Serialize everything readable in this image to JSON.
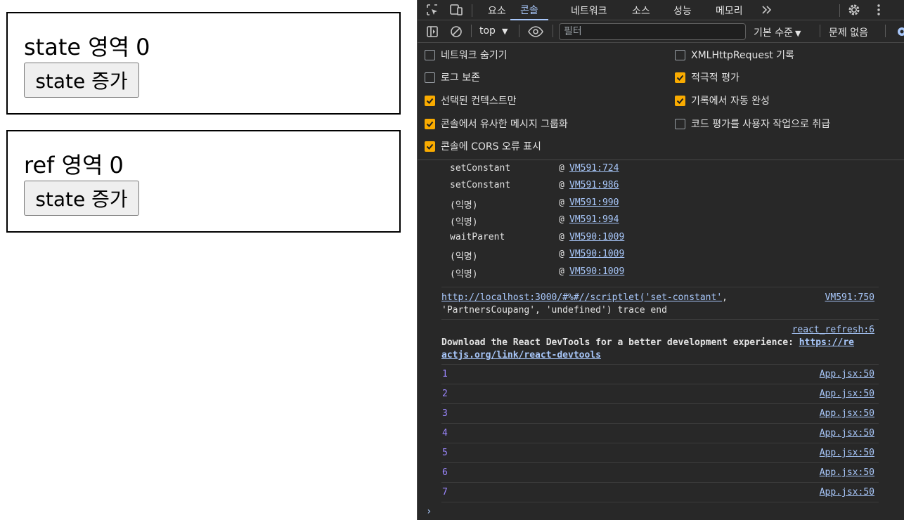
{
  "page": {
    "state_box": {
      "label": "state 영역",
      "value": "0",
      "button": "state 증가"
    },
    "ref_box": {
      "label": "ref 영역",
      "value": "0",
      "button": "state 증가"
    }
  },
  "devtools": {
    "tabs": [
      "요소",
      "콘솔",
      "네트워크",
      "소스",
      "성능",
      "메모리"
    ],
    "active_tab": "콘솔",
    "more_tabs_icon": "chevron-double-right-icon",
    "toolbar": {
      "context": "top",
      "filter_placeholder": "필터",
      "log_level": "기본 수준",
      "issues": "문제 없음"
    },
    "settings": {
      "left": [
        {
          "label": "네트워크 숨기기",
          "checked": false
        },
        {
          "label": "로그 보존",
          "checked": false
        },
        {
          "label": "선택된 컨텍스트만",
          "checked": true
        },
        {
          "label": "콘솔에서 유사한 메시지 그룹화",
          "checked": true
        },
        {
          "label": "콘솔에 CORS 오류 표시",
          "checked": true
        }
      ],
      "right": [
        {
          "label": "XMLHttpRequest 기록",
          "checked": false
        },
        {
          "label": "적극적 평가",
          "checked": true
        },
        {
          "label": "기록에서 자동 완성",
          "checked": true
        },
        {
          "label": "코드 평가를 사용자 작업으로 취급",
          "checked": false
        }
      ]
    },
    "console": {
      "stack": [
        {
          "fn": "setConstant",
          "at": "@",
          "loc": "VM591:724"
        },
        {
          "fn": "setConstant",
          "at": "@",
          "loc": "VM591:986"
        },
        {
          "fn": "(익명)",
          "at": "@",
          "loc": "VM591:990"
        },
        {
          "fn": "(익명)",
          "at": "@",
          "loc": "VM591:994"
        },
        {
          "fn": "waitParent",
          "at": "@",
          "loc": "VM590:1009"
        },
        {
          "fn": "(익명)",
          "at": "@",
          "loc": "VM590:1009"
        },
        {
          "fn": "(익명)",
          "at": "@",
          "loc": "VM590:1009"
        }
      ],
      "scriptlet_msg": {
        "link": "http://localhost:3000/#%#//scriptlet('set-constant'",
        "rest1": ",",
        "line2": "'PartnersCoupang', 'undefined') trace end",
        "source": "VM591:750"
      },
      "devtools_msg": {
        "source": "react_refresh:6",
        "text": "Download the React DevTools for a better development experience: ",
        "link_part1": "https://re",
        "link_part2": "actjs.org/link/react-devtools"
      },
      "logs": [
        {
          "value": "1",
          "source": "App.jsx:50"
        },
        {
          "value": "2",
          "source": "App.jsx:50"
        },
        {
          "value": "3",
          "source": "App.jsx:50"
        },
        {
          "value": "4",
          "source": "App.jsx:50"
        },
        {
          "value": "5",
          "source": "App.jsx:50"
        },
        {
          "value": "6",
          "source": "App.jsx:50"
        },
        {
          "value": "7",
          "source": "App.jsx:50"
        }
      ],
      "prompt": "›"
    }
  }
}
